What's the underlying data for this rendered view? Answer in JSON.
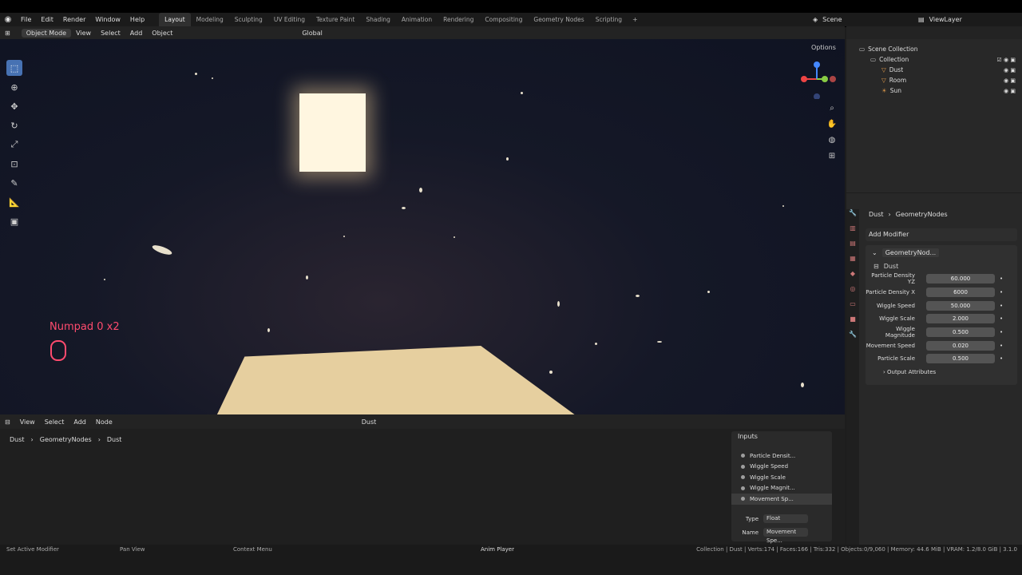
{
  "menu": {
    "items": [
      "File",
      "Edit",
      "Render",
      "Window",
      "Help"
    ]
  },
  "workspaces": [
    "Layout",
    "Modeling",
    "Sculpting",
    "UV Editing",
    "Texture Paint",
    "Shading",
    "Animation",
    "Rendering",
    "Compositing",
    "Geometry Nodes",
    "Scripting"
  ],
  "scene": {
    "name": "Scene"
  },
  "viewlayer": {
    "name": "ViewLayer"
  },
  "viewport_header": {
    "mode": "Object Mode",
    "view": "View",
    "select": "Select",
    "add": "Add",
    "object": "Object",
    "orientation": "Global",
    "options": "Options"
  },
  "overlay": {
    "keypress": "Numpad 0 x2"
  },
  "outliner": {
    "scene_collection": "Scene Collection",
    "collection": "Collection",
    "objects": [
      "Dust",
      "Room",
      "Sun"
    ]
  },
  "properties": {
    "breadcrumb": [
      "Dust",
      "GeometryNodes"
    ],
    "add_modifier": "Add Modifier",
    "modifier_name": "GeometryNod...",
    "node_group": "Dust",
    "inputs": [
      {
        "label": "Particle Density YZ",
        "value": "60.000"
      },
      {
        "label": "Particle Density X",
        "value": "6000"
      },
      {
        "label": "Wiggle Speed",
        "value": "50.000"
      },
      {
        "label": "Wiggle Scale",
        "value": "2.000"
      },
      {
        "label": "Wiggle Magnitude",
        "value": "0.500"
      },
      {
        "label": "Movement Speed",
        "value": "0.020"
      },
      {
        "label": "Particle Scale",
        "value": "0.500"
      }
    ],
    "output_attributes": "Output Attributes"
  },
  "node_editor": {
    "header": {
      "view": "View",
      "select": "Select",
      "add": "Add",
      "node": "Node",
      "group": "Dust"
    },
    "breadcrumb": [
      "Dust",
      "GeometryNodes",
      "Dust"
    ],
    "inputs_panel": {
      "title": "Inputs",
      "sockets": [
        "Particle Densit...",
        "Wiggle Speed",
        "Wiggle Scale",
        "Wiggle Magnit...",
        "Movement Sp..."
      ],
      "type_label": "Type",
      "type_value": "Float",
      "name_label": "Name",
      "name_value": "Movement Spe..."
    }
  },
  "statusbar": {
    "left": "Set Active Modifier",
    "mid": "Pan View",
    "ctx": "Context Menu",
    "anim": "Anim Player",
    "stats": "Collection | Dust | Verts:174 | Faces:166 | Tris:332 | Objects:0/9,060 | Memory: 44.6 MiB | VRAM: 1.2/8.0 GiB | 3.1.0"
  }
}
